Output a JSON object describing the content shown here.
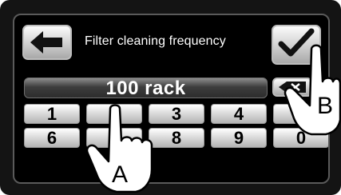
{
  "screen": {
    "title": "Filter cleaning frequency",
    "value_display": "100 rack"
  },
  "icons": {
    "back": "back-arrow-icon",
    "confirm": "checkmark-icon",
    "delete": "backspace-icon"
  },
  "keypad": {
    "row1": [
      "1",
      "2",
      "3",
      "4",
      "5"
    ],
    "row2": [
      "6",
      "7",
      "8",
      "9",
      "0"
    ]
  },
  "callouts": {
    "a": "A",
    "b": "B"
  },
  "colors": {
    "screen_bg": "#000000",
    "button_face": "#d9d9d9",
    "text": "#ffffff"
  }
}
